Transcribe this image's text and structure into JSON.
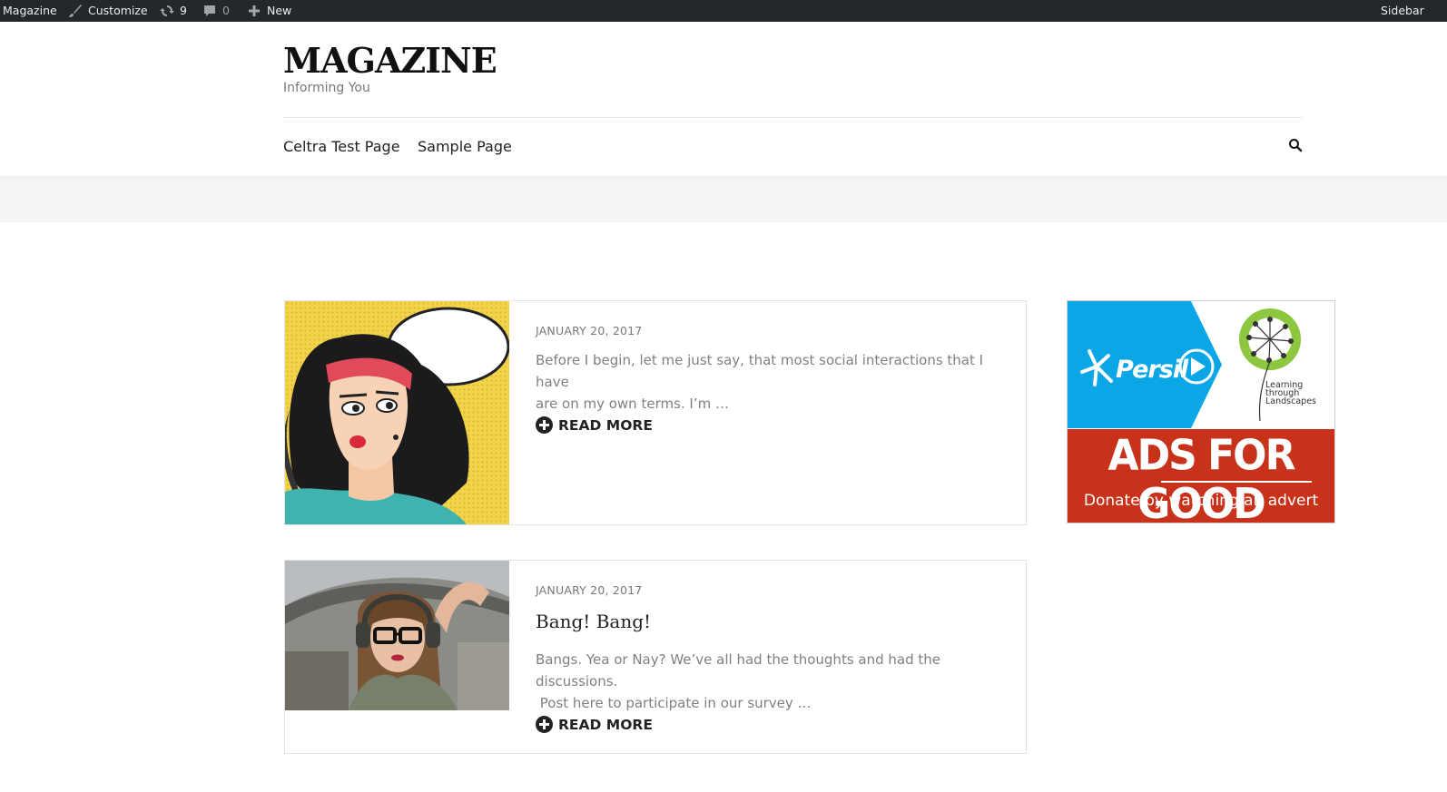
{
  "admin_bar": {
    "site_name": "Magazine",
    "customize_label": "Customize",
    "updates_count": "9",
    "comments_count": "0",
    "new_label": "New",
    "right_label": "Sidebar"
  },
  "header": {
    "title": "MAGAZINE",
    "tagline": "Informing You"
  },
  "nav": {
    "items": [
      {
        "label": "Celtra Test Page"
      },
      {
        "label": "Sample Page"
      }
    ]
  },
  "posts": [
    {
      "date": "JANUARY 20, 2017",
      "title": "",
      "excerpt_lines": [
        "Before I begin, let me just say, that most social interactions that I have",
        "are on my own terms.  I’m …"
      ],
      "read_more": "READ MORE",
      "image": "pop-art-woman-speech-bubble"
    },
    {
      "date": "JANUARY 20, 2017",
      "title": "Bang! Bang!",
      "excerpt_lines": [
        "Bangs. Yea or Nay? We’ve all had the thoughts and had the discussions.",
        " Post here to participate in our survey …"
      ],
      "read_more": "READ MORE",
      "image": "woman-pilot-headset"
    }
  ],
  "ad": {
    "brand": "Persil",
    "partner_lines": [
      "Learning",
      "through",
      "Landscapes"
    ],
    "headline": "ADS FOR GOOD",
    "subline": "Donate by watching an advert",
    "colors": {
      "blue": "#0aa6e6",
      "red": "#c9321a",
      "green": "#8dc63f"
    }
  },
  "icons": {
    "customize": "brush-icon",
    "updates": "refresh-icon",
    "comments": "comment-icon",
    "new": "plus-icon",
    "search": "search-icon",
    "read_more": "plus-circle-icon"
  }
}
